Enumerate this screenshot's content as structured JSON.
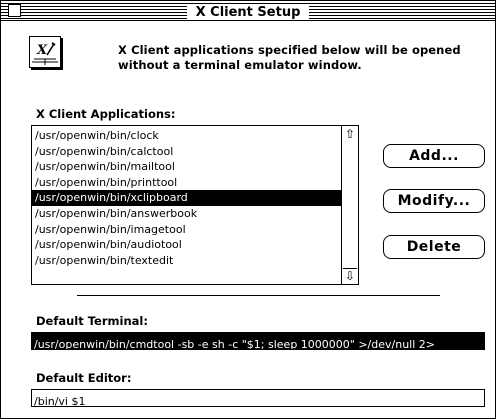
{
  "window": {
    "title": "X Client Setup"
  },
  "intro": {
    "line1": "X Client applications specified below will be opened",
    "line2": "without a terminal emulator window.",
    "icon": "x-client-app-icon"
  },
  "clients": {
    "label": "X Client Applications:",
    "items": [
      "/usr/openwin/bin/clock",
      "/usr/openwin/bin/calctool",
      "/usr/openwin/bin/mailtool",
      "/usr/openwin/bin/printtool",
      "/usr/openwin/bin/xclipboard",
      "/usr/openwin/bin/answerbook",
      "/usr/openwin/bin/imagetool",
      "/usr/openwin/bin/audiotool",
      "/usr/openwin/bin/textedit"
    ],
    "selected_index": 4
  },
  "buttons": {
    "add": "Add...",
    "modify": "Modify...",
    "delete": "Delete"
  },
  "terminal": {
    "label": "Default Terminal:",
    "value": "/usr/openwin/bin/cmdtool -sb -e sh -c \"$1; sleep 1000000\" >/dev/null 2>"
  },
  "editor": {
    "label": "Default Editor:",
    "value": "/bin/vi $1"
  }
}
